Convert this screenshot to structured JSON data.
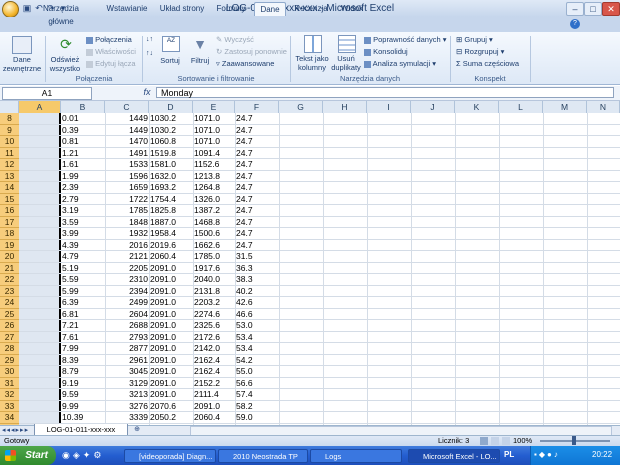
{
  "window": {
    "title": "LOG-01-011-xxx-xxx  -  Microsoft Excel",
    "minimize": "–",
    "maximize": "□",
    "close": "✕"
  },
  "ribbon_tabs": [
    "Narzędzia główne",
    "Wstawianie",
    "Układ strony",
    "Formuły",
    "Dane",
    "Recenzja",
    "Widok"
  ],
  "active_tab": "Dane",
  "ribbon": {
    "dane_zewnetrzne": "Dane zewnętrzne",
    "odswiez": "Odśwież wszystko",
    "polaczenia": "Połączenia",
    "wlasciwosci": "Właściwości",
    "edytuj_lacza": "Edytuj łącza",
    "group_polaczenia": "Połączenia",
    "sortuj_az": "AZ",
    "sortuj": "Sortuj",
    "filtruj": "Filtruj",
    "wyczysc": "Wyczyść",
    "zastosuj": "Zastosuj ponownie",
    "zaawansowane": "Zaawansowane",
    "group_sort": "Sortowanie i filtrowanie",
    "tekst_jako_kolumny": "Tekst jako kolumny",
    "usun_duplikaty": "Usuń duplikaty",
    "poprawnosc": "Poprawność danych ▾",
    "konsoliduj": "Konsoliduj",
    "analiza": "Analiza symulacji ▾",
    "group_narzedzia": "Narzędzia danych",
    "grupuj": "Grupuj ▾",
    "rozgrupuj": "Rozgrupuj ▾",
    "suma_czesciowa": "Suma częściowa",
    "group_konspekt": "Konspekt"
  },
  "formula_bar": {
    "name_box": "A1",
    "fx": "fx",
    "value": "Monday"
  },
  "columns": [
    "A",
    "B",
    "C",
    "D",
    "E",
    "F",
    "G",
    "H",
    "I",
    "J",
    "K",
    "L",
    "M",
    "N"
  ],
  "rows": [
    {
      "n": "8",
      "b": "0.01",
      "c": "1449",
      "d": "1030.2",
      "e": "1071.0",
      "f": "24.7"
    },
    {
      "n": "9",
      "b": "0.39",
      "c": "1449",
      "d": "1030.2",
      "e": "1071.0",
      "f": "24.7"
    },
    {
      "n": "10",
      "b": "0.81",
      "c": "1470",
      "d": "1060.8",
      "e": "1071.0",
      "f": "24.7"
    },
    {
      "n": "11",
      "b": "1.21",
      "c": "1491",
      "d": "1519.8",
      "e": "1091.4",
      "f": "24.7"
    },
    {
      "n": "12",
      "b": "1.61",
      "c": "1533",
      "d": "1581.0",
      "e": "1152.6",
      "f": "24.7"
    },
    {
      "n": "13",
      "b": "1.99",
      "c": "1596",
      "d": "1632.0",
      "e": "1213.8",
      "f": "24.7"
    },
    {
      "n": "14",
      "b": "2.39",
      "c": "1659",
      "d": "1693.2",
      "e": "1264.8",
      "f": "24.7"
    },
    {
      "n": "15",
      "b": "2.79",
      "c": "1722",
      "d": "1754.4",
      "e": "1326.0",
      "f": "24.7"
    },
    {
      "n": "16",
      "b": "3.19",
      "c": "1785",
      "d": "1825.8",
      "e": "1387.2",
      "f": "24.7"
    },
    {
      "n": "17",
      "b": "3.59",
      "c": "1848",
      "d": "1887.0",
      "e": "1468.8",
      "f": "24.7"
    },
    {
      "n": "18",
      "b": "3.99",
      "c": "1932",
      "d": "1958.4",
      "e": "1500.6",
      "f": "24.7"
    },
    {
      "n": "19",
      "b": "4.39",
      "c": "2016",
      "d": "2019.6",
      "e": "1662.6",
      "f": "24.7"
    },
    {
      "n": "20",
      "b": "4.79",
      "c": "2121",
      "d": "2060.4",
      "e": "1785.0",
      "f": "31.5"
    },
    {
      "n": "21",
      "b": "5.19",
      "c": "2205",
      "d": "2091.0",
      "e": "1917.6",
      "f": "36.3"
    },
    {
      "n": "22",
      "b": "5.59",
      "c": "2310",
      "d": "2091.0",
      "e": "2040.0",
      "f": "38.3"
    },
    {
      "n": "23",
      "b": "5.99",
      "c": "2394",
      "d": "2091.0",
      "e": "2131.8",
      "f": "40.2"
    },
    {
      "n": "24",
      "b": "6.39",
      "c": "2499",
      "d": "2091.0",
      "e": "2203.2",
      "f": "42.6"
    },
    {
      "n": "25",
      "b": "6.81",
      "c": "2604",
      "d": "2091.0",
      "e": "2274.6",
      "f": "46.6"
    },
    {
      "n": "26",
      "b": "7.21",
      "c": "2688",
      "d": "2091.0",
      "e": "2325.6",
      "f": "53.0"
    },
    {
      "n": "27",
      "b": "7.61",
      "c": "2793",
      "d": "2091.0",
      "e": "2172.6",
      "f": "53.4"
    },
    {
      "n": "28",
      "b": "7.99",
      "c": "2877",
      "d": "2091.0",
      "e": "2142.0",
      "f": "53.4"
    },
    {
      "n": "29",
      "b": "8.39",
      "c": "2961",
      "d": "2091.0",
      "e": "2162.4",
      "f": "54.2"
    },
    {
      "n": "30",
      "b": "8.79",
      "c": "3045",
      "d": "2091.0",
      "e": "2162.4",
      "f": "55.0"
    },
    {
      "n": "31",
      "b": "9.19",
      "c": "3129",
      "d": "2091.0",
      "e": "2152.2",
      "f": "56.6"
    },
    {
      "n": "32",
      "b": "9.59",
      "c": "3213",
      "d": "2091.0",
      "e": "2111.4",
      "f": "57.4"
    },
    {
      "n": "33",
      "b": "9.99",
      "c": "3276",
      "d": "2070.6",
      "e": "2091.0",
      "f": "58.2"
    },
    {
      "n": "34",
      "b": "10.39",
      "c": "3339",
      "d": "2050.2",
      "e": "2060.4",
      "f": "59.0"
    }
  ],
  "sheet_tab": "LOG-01-011-xxx-xxx",
  "status": {
    "ready": "Gotowy",
    "count": "Licznik: 3",
    "zoom": "100%"
  },
  "taskbar": {
    "start": "Start",
    "items": [
      "[videoporada] Diagn...",
      "2010 Neostrada TP",
      "Logs",
      "Microsoft Excel - LO..."
    ],
    "lang": "PL",
    "clock": "20:22"
  },
  "colors": {
    "accent": "#245ed0",
    "row_header": "#f7cd7c",
    "ribbon": "#dde8f6"
  }
}
